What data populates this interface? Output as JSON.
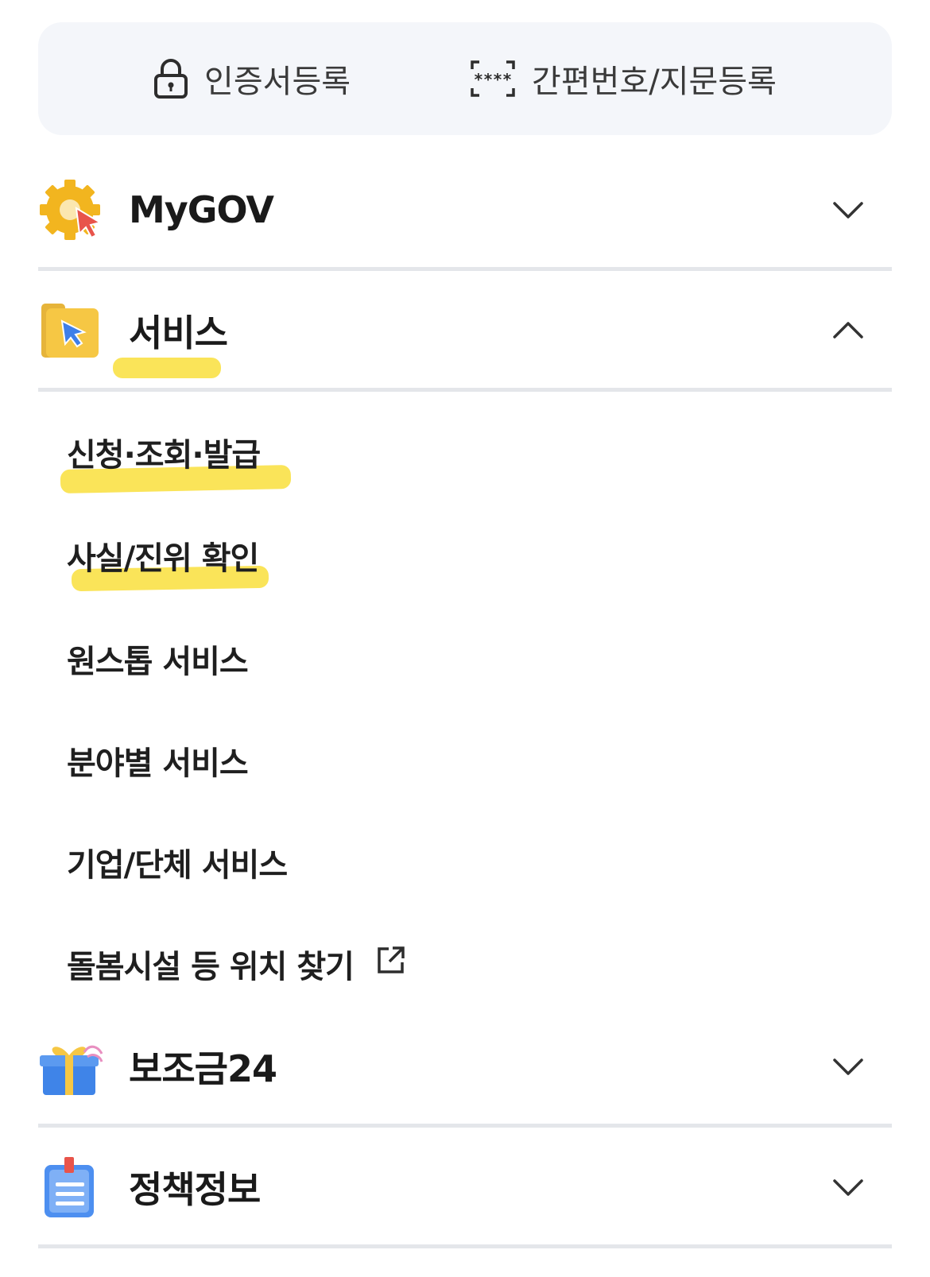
{
  "auth": {
    "cert_label": "인증서등록",
    "pin_label": "간편번호/지문등록"
  },
  "sections": {
    "mygov": {
      "title": "MyGOV",
      "state": "collapsed"
    },
    "service": {
      "title": "서비스",
      "state": "expanded",
      "items": [
        {
          "label": "신청·조회·발급"
        },
        {
          "label": "사실/진위 확인"
        },
        {
          "label": "원스톱 서비스"
        },
        {
          "label": "분야별 서비스"
        },
        {
          "label": "기업/단체 서비스"
        },
        {
          "label": "돌봄시설 등 위치 찾기",
          "external": true
        }
      ]
    },
    "subsidy": {
      "title": "보조금24",
      "state": "collapsed"
    },
    "policy": {
      "title": "정책정보",
      "state": "collapsed"
    }
  },
  "icons": {
    "cert": "lock-icon",
    "pin": "pin-scan-icon",
    "mygov": "gear-cursor-icon",
    "service": "folder-cursor-icon",
    "subsidy": "gift-box-icon",
    "policy": "clipboard-icon",
    "external": "external-link-icon",
    "collapsed": "chevron-down-icon",
    "expanded": "chevron-up-icon"
  },
  "colors": {
    "highlight": "#f9df3c",
    "auth_bg": "#f4f6fa",
    "divider": "#e4e6ea"
  }
}
